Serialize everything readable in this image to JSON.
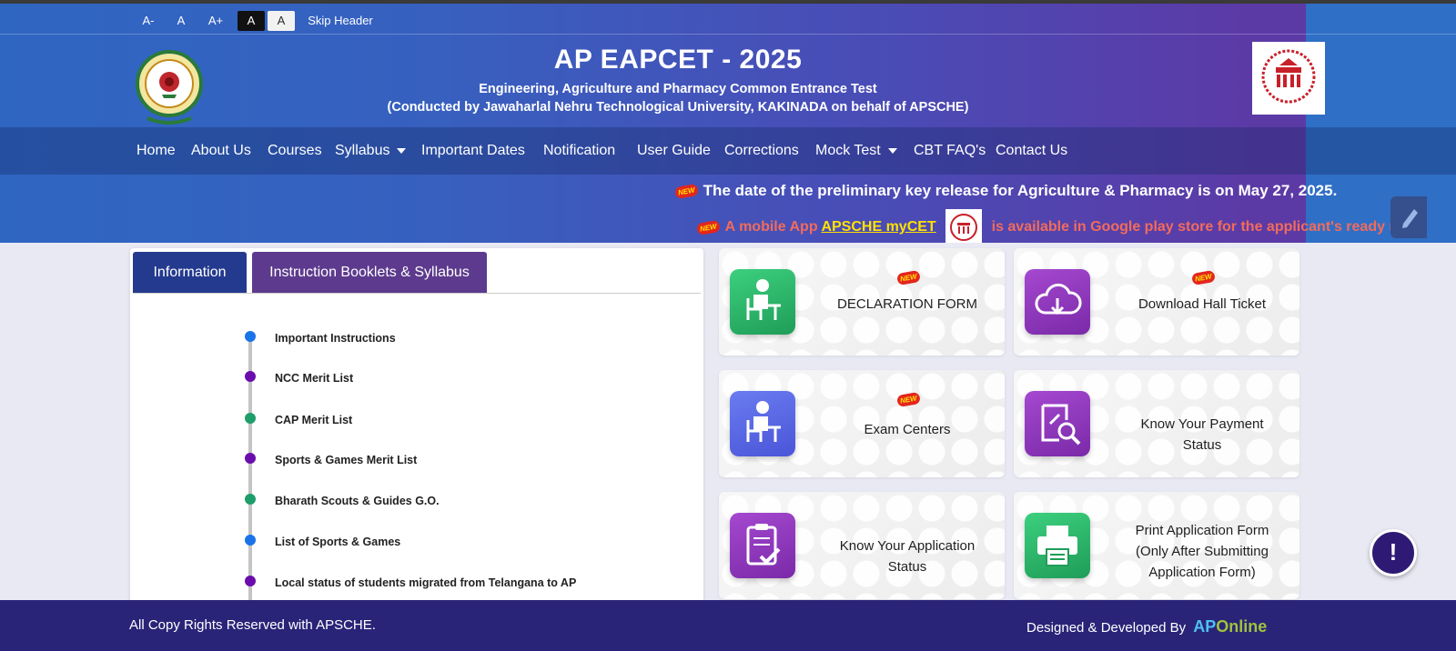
{
  "accessibility": {
    "font_decrease": "A-",
    "font_normal": "A",
    "font_increase": "A+",
    "contrast_dark": "A",
    "contrast_light": "A",
    "skip_header": "Skip Header"
  },
  "header": {
    "title": "AP EAPCET - 2025",
    "subtitle": "Engineering, Agriculture and Pharmacy Common Entrance Test",
    "conducted_by": "(Conducted by Jawaharlal Nehru Technological University, KAKINADA on behalf of APSCHE)"
  },
  "nav": {
    "home": "Home",
    "about": "About Us",
    "courses": "Courses",
    "syllabus": "Syllabus",
    "important_dates": "Important Dates",
    "notification": "Notification",
    "user_guide": "User Guide",
    "corrections": "Corrections",
    "mock_test": "Mock Test",
    "cbt_faq": "CBT FAQ's",
    "contact": "Contact Us"
  },
  "announcements": {
    "new_badge": "NEW",
    "line1": "The date of the preliminary key release for Agriculture & Pharmacy is on May 27, 2025.",
    "line2_prefix": "A mobile App",
    "line2_link": "APSCHE myCET",
    "line2_suffix": "is available in Google play store for the applicant's ready re"
  },
  "info_panel": {
    "tabs": [
      "Information",
      "Instruction Booklets & Syllabus"
    ],
    "items": [
      {
        "label": "Important Instructions",
        "color": "#1a73e8"
      },
      {
        "label": "NCC Merit List",
        "color": "#6a0dad"
      },
      {
        "label": "CAP Merit List",
        "color": "#1f9d6a"
      },
      {
        "label": "Sports & Games Merit List",
        "color": "#6a0dad"
      },
      {
        "label": "Bharath Scouts & Guides G.O.",
        "color": "#1f9d6a"
      },
      {
        "label": "List of Sports & Games",
        "color": "#1a73e8"
      },
      {
        "label": "Local status of students migrated from Telangana to AP",
        "color": "#6a0dad"
      }
    ]
  },
  "services": {
    "declaration": {
      "line1": "DECLARATION FORM",
      "icon": "student-desk-icon"
    },
    "hall_ticket": {
      "line1": "Download Hall Ticket",
      "icon": "cloud-download-icon"
    },
    "exam_centers": {
      "line1": "Exam Centers",
      "icon": "student-desk-icon"
    },
    "payment_status": {
      "line1": "Know Your Payment",
      "line2": "Status",
      "icon": "search-document-icon"
    },
    "application_status": {
      "line1": "Know Your Application",
      "line2": "Status",
      "icon": "clipboard-check-icon"
    },
    "print_application": {
      "line1": "Print Application Form",
      "line2": "(Only After Submitting",
      "line3": "Application Form)",
      "icon": "printer-icon"
    }
  },
  "footer": {
    "copyright": "All Copy Rights Reserved with APSCHE.",
    "designed_by": "Designed & Developed By",
    "brand_ap": "AP",
    "brand_online": "Online"
  },
  "help_button": {
    "label": "!"
  }
}
